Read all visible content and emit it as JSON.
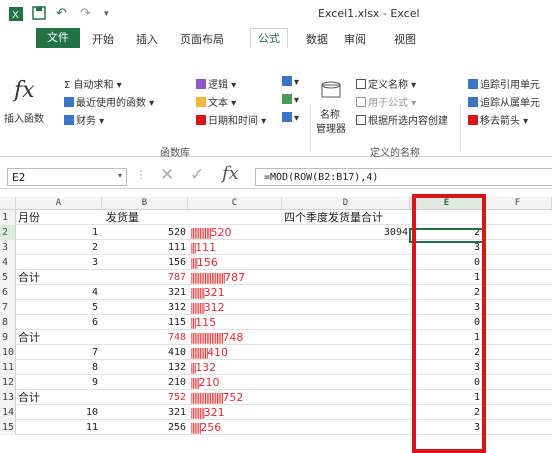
{
  "window": {
    "title": "Excel1.xlsx - Excel"
  },
  "quick_access": {
    "undo": "↶",
    "redo": "↷"
  },
  "menu": {
    "file": "文件",
    "tabs": [
      "开始",
      "插入",
      "页面布局",
      "公式",
      "数据",
      "审阅",
      "视图"
    ],
    "active": "公式"
  },
  "ribbon": {
    "insert_function": "插入函数",
    "fx": "fx",
    "autosum": "Σ 自动求和 ▾",
    "recent": "最近使用的函数 ▾",
    "finance": "财务 ▾",
    "logic": "逻辑 ▾",
    "text": "文本 ▾",
    "datetime": "日期和时间 ▾",
    "group1": "函数库",
    "name_manager_line1": "名称",
    "name_manager_line2": "管理器",
    "define_name": "定义名称 ▾",
    "use_in_formula": "用于公式 ▾",
    "create_from_selection": "根据所选内容创建",
    "group2": "定义的名称",
    "trace_precedents": "追踪引用单元",
    "trace_dependents": "追踪从属单元",
    "remove_arrows": "移去箭头 ▾"
  },
  "formula_bar": {
    "name_box": "E2",
    "cancel": "✕",
    "enter": "✓",
    "fx": "fx",
    "formula": "=MOD(ROW(B2:B17),4)"
  },
  "columns": [
    "A",
    "B",
    "C",
    "D",
    "E",
    "F"
  ],
  "rows": [
    {
      "n": "1",
      "a": "月份",
      "a_num": "",
      "b": "发货量",
      "bar": "",
      "barval": "",
      "d": "四个季度发货量合计",
      "e": ""
    },
    {
      "n": "2",
      "a": "",
      "a_num": "1",
      "b": "520",
      "bar": "||||||||||||",
      "barval": "520",
      "d": "3094",
      "e": "2"
    },
    {
      "n": "3",
      "a": "",
      "a_num": "2",
      "b": "111",
      "bar": "|||",
      "barval": "111",
      "d": "",
      "e": "3"
    },
    {
      "n": "4",
      "a": "",
      "a_num": "3",
      "b": "156",
      "bar": "||||",
      "barval": "156",
      "d": "",
      "e": "0"
    },
    {
      "n": "5",
      "a": "合计",
      "a_num": "",
      "b": "787",
      "bar": "||||||||||||||||||||",
      "barval": "787",
      "d": "",
      "e": "1"
    },
    {
      "n": "6",
      "a": "",
      "a_num": "4",
      "b": "321",
      "bar": "||||||||",
      "barval": "321",
      "d": "",
      "e": "2"
    },
    {
      "n": "7",
      "a": "",
      "a_num": "5",
      "b": "312",
      "bar": "||||||||",
      "barval": "312",
      "d": "",
      "e": "3"
    },
    {
      "n": "8",
      "a": "",
      "a_num": "6",
      "b": "115",
      "bar": "|||",
      "barval": "115",
      "d": "",
      "e": "0"
    },
    {
      "n": "9",
      "a": "合计",
      "a_num": "",
      "b": "748",
      "bar": "|||||||||||||||||||",
      "barval": "748",
      "d": "",
      "e": "1"
    },
    {
      "n": "10",
      "a": "",
      "a_num": "7",
      "b": "410",
      "bar": "||||||||||",
      "barval": "410",
      "d": "",
      "e": "2"
    },
    {
      "n": "11",
      "a": "",
      "a_num": "8",
      "b": "132",
      "bar": "|||",
      "barval": "132",
      "d": "",
      "e": "3"
    },
    {
      "n": "12",
      "a": "",
      "a_num": "9",
      "b": "210",
      "bar": "|||||",
      "barval": "210",
      "d": "",
      "e": "0"
    },
    {
      "n": "13",
      "a": "合计",
      "a_num": "",
      "b": "752",
      "bar": "|||||||||||||||||||",
      "barval": "752",
      "d": "",
      "e": "1"
    },
    {
      "n": "14",
      "a": "",
      "a_num": "10",
      "b": "321",
      "bar": "||||||||",
      "barval": "321",
      "d": "",
      "e": "2"
    },
    {
      "n": "15",
      "a": "",
      "a_num": "11",
      "b": "256",
      "bar": "||||||",
      "barval": "256",
      "d": "",
      "e": "3"
    }
  ],
  "colors": {
    "excel_green": "#217346",
    "bar_red": "#e03030",
    "highlight_red": "#d9141b"
  }
}
